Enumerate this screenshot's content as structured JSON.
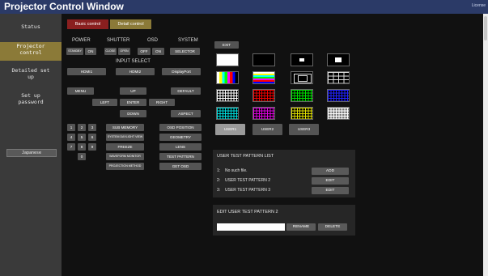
{
  "app": {
    "title": "Projector Control Window",
    "license_link": "License"
  },
  "sidebar": {
    "items": [
      "Status",
      "Projector control",
      "Detailed set up",
      "Set up password"
    ],
    "language_button": "Japanese"
  },
  "tabs": {
    "basic": "Basic control",
    "detail": "Detail control"
  },
  "groups": {
    "power": "POWER",
    "shutter": "SHUTTER",
    "osd": "OSD",
    "system": "SYSTEM",
    "input_select": "INPUT SELECT"
  },
  "controls": {
    "standby": "STANDBY",
    "on": "ON",
    "close": "CLOSE",
    "open": "OPEN",
    "osd_off": "OFF",
    "osd_on": "ON",
    "selector": "SELECTOR",
    "hdmi1": "HDMI1",
    "hdmi2": "HDMI2",
    "displayport": "DisplayPort",
    "menu": "MENU",
    "up": "UP",
    "default": "DEFAULT",
    "left": "LEFT",
    "enter": "ENTER",
    "right": "RIGHT",
    "down": "DOWN",
    "aspect": "ASPECT"
  },
  "keypad": [
    "1",
    "2",
    "3",
    "4",
    "5",
    "6",
    "7",
    "8",
    "9",
    "0"
  ],
  "functions": {
    "sub_memory": "SUB MEMORY",
    "system_daylight_view": "SYSTEM DAYLIGHT VIEW",
    "freeze": "FREEZE",
    "waveform_monitor": "WAVEFORM MONITOR",
    "projection_method": "PROJECTION METHOD",
    "osd_position": "OSD POSITION",
    "geometry": "GEOMETRY",
    "lens": "LENS",
    "test_pattern": "TEST PATTERN",
    "get_osd": "GET OSD"
  },
  "test_patterns": {
    "exit": "EXIT",
    "users": [
      "USER1",
      "USER2",
      "USER3"
    ],
    "selected_user": "USER1",
    "swatches": [
      "white-pattern",
      "black-pattern",
      "white-box-small",
      "white-box-large",
      "color-bars-vertical",
      "color-bars-horizontal",
      "focus-frame",
      "cross-grid",
      "white-grid",
      "red-grid",
      "green-grid",
      "blue-grid",
      "cyan-grid",
      "magenta-grid",
      "yellow-grid",
      "white-grid-on-gray"
    ]
  },
  "user_list": {
    "title": "USER TEST PATTERN LIST",
    "rows": [
      {
        "index": "1:",
        "name": "No such file.",
        "action": "ADD"
      },
      {
        "index": "2:",
        "name": "USER TEST PATTERN 2",
        "action": "EDIT"
      },
      {
        "index": "3:",
        "name": "USER TEST PATTERN 3",
        "action": "EDIT"
      }
    ]
  },
  "edit_panel": {
    "title": "EDIT USER TEST PATTERN 2",
    "name_value": "",
    "rename": "RENAME",
    "delete": "DELETE"
  },
  "colors": {
    "title_bar": "#2b3a67",
    "sidebar": "#3a3a3a",
    "accent": "#8b7a38",
    "main_bg": "#111111",
    "button": "#545454",
    "selected_user": "#9a9a9a"
  }
}
